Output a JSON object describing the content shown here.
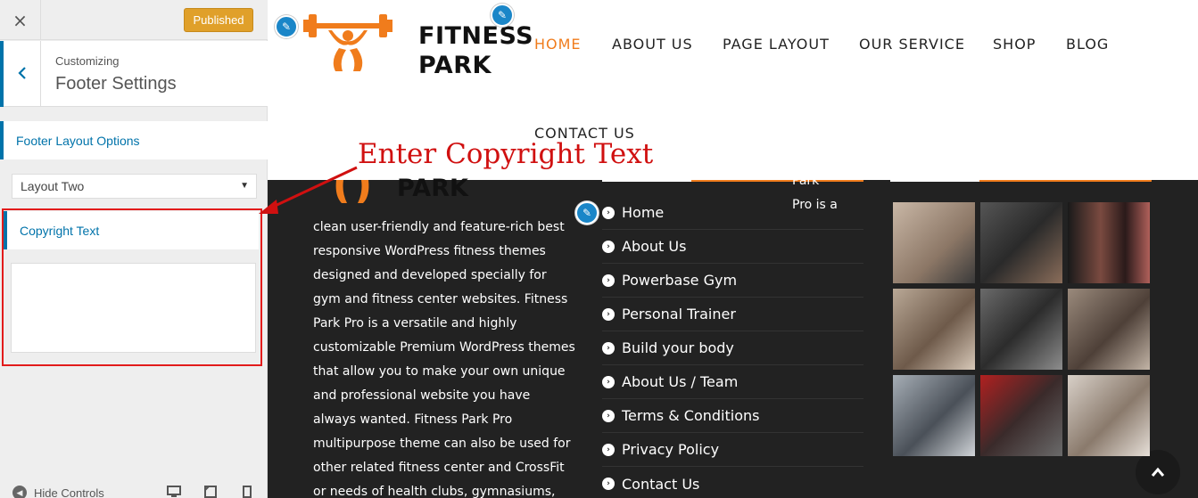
{
  "sidebar": {
    "close_icon": "×",
    "published_label": "Published",
    "back_icon": "‹",
    "customizing_label": "Customizing",
    "section_title": "Footer Settings",
    "footer_layout_options_label": "Footer Layout Options",
    "layout_select_value": "Layout Two",
    "copyright_text_label": "Copyright Text",
    "copyright_text_value": "",
    "hide_controls_label": "Hide Controls"
  },
  "header": {
    "logo_line1": "FITNESS",
    "logo_line2": "PARK",
    "nav": [
      "HOME",
      "ABOUT US",
      "PAGE LAYOUT",
      "OUR SERVICE",
      "SHOP",
      "BLOG",
      "CONTACT US"
    ],
    "active_nav": "HOME"
  },
  "footer": {
    "logo_line2": "PARK",
    "about_head": "Park\nPro is a",
    "about_text": "clean user-friendly and feature-rich best responsive WordPress fitness themes designed and developed specially for gym and fitness center websites. Fitness Park Pro is a versatile and highly customizable Premium WordPress themes that allow you to make your own unique and professional website you have always wanted. Fitness Park Pro multipurpose theme can also be used for other related fitness center and CrossFit or needs of health clubs, gymnasiums,",
    "menu": [
      "Home",
      "About Us",
      "Powerbase Gym",
      "Personal Trainer",
      "Build your body",
      "About Us / Team",
      "Terms & Conditions",
      "Privacy Policy",
      "Contact Us"
    ],
    "back_to_top_icon": "chevron-up-icon"
  },
  "annotation": {
    "text": "Enter Copyright Text"
  },
  "colors": {
    "accent_orange": "#f07c1c",
    "wp_blue": "#0073aa",
    "published_orange": "#e0a02a",
    "annotation_red": "#d01010",
    "footer_bg": "#222222"
  }
}
